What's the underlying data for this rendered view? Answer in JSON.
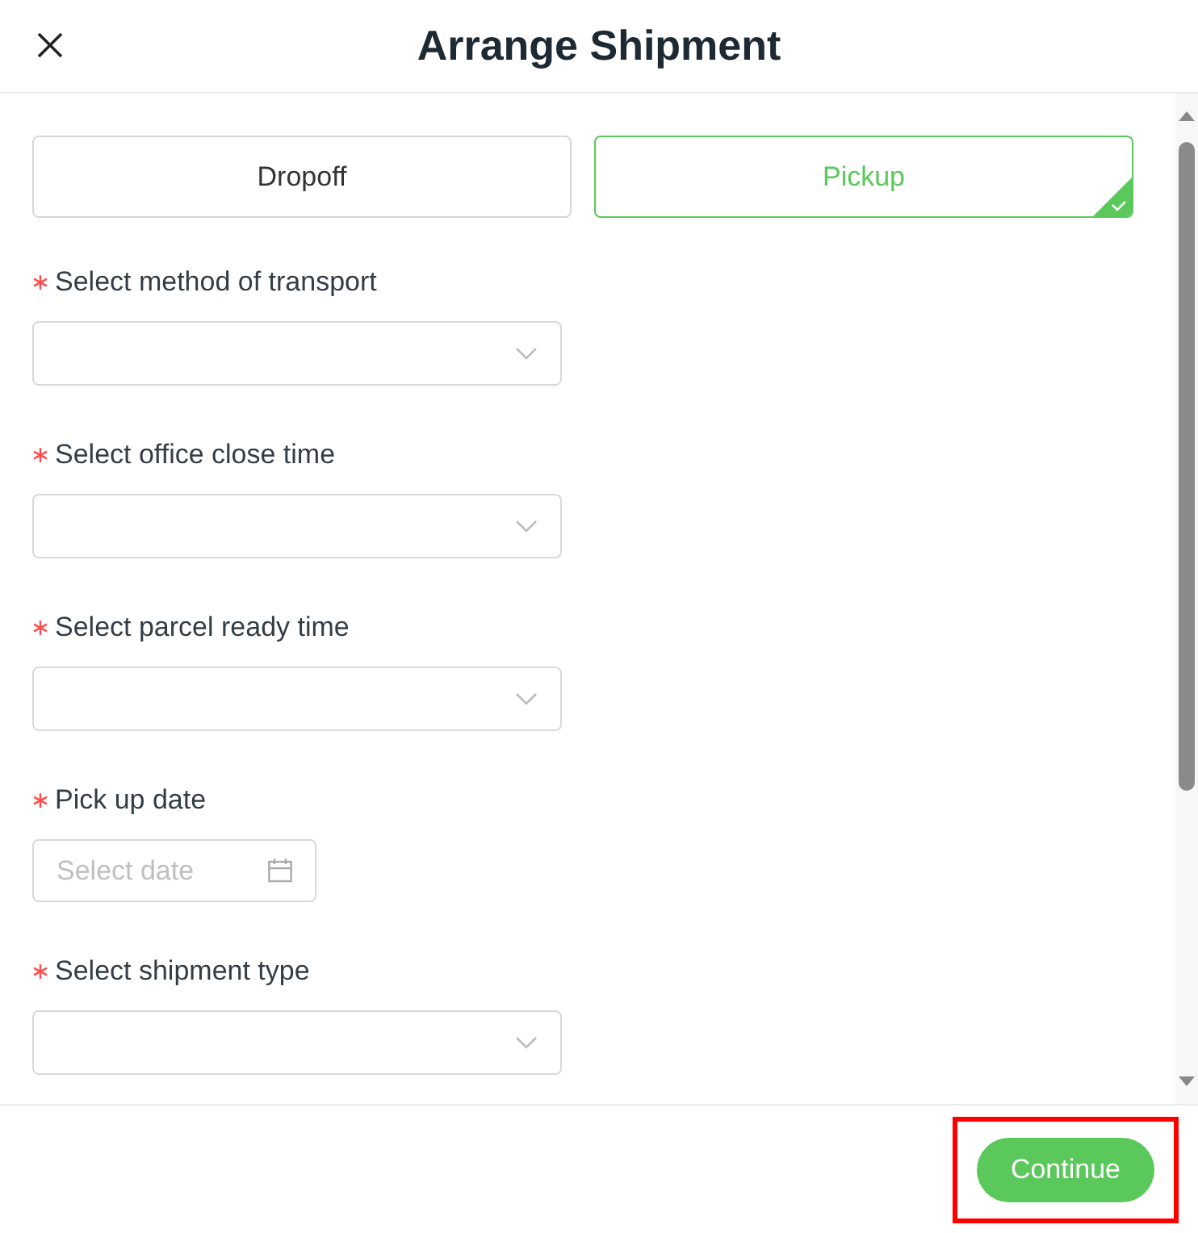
{
  "header": {
    "title": "Arrange Shipment"
  },
  "modes": [
    {
      "label": "Dropoff",
      "selected": false
    },
    {
      "label": "Pickup",
      "selected": true
    }
  ],
  "fields": [
    {
      "kind": "select",
      "label": "Select method of transport",
      "required": true
    },
    {
      "kind": "select",
      "label": "Select office close time",
      "required": true
    },
    {
      "kind": "select",
      "label": "Select parcel ready time",
      "required": true
    },
    {
      "kind": "date",
      "label": "Pick up date",
      "required": true,
      "placeholder": "Select date"
    },
    {
      "kind": "select",
      "label": "Select shipment type",
      "required": true
    }
  ],
  "continue_button": {
    "label": "Continue",
    "highlighted": true
  }
}
